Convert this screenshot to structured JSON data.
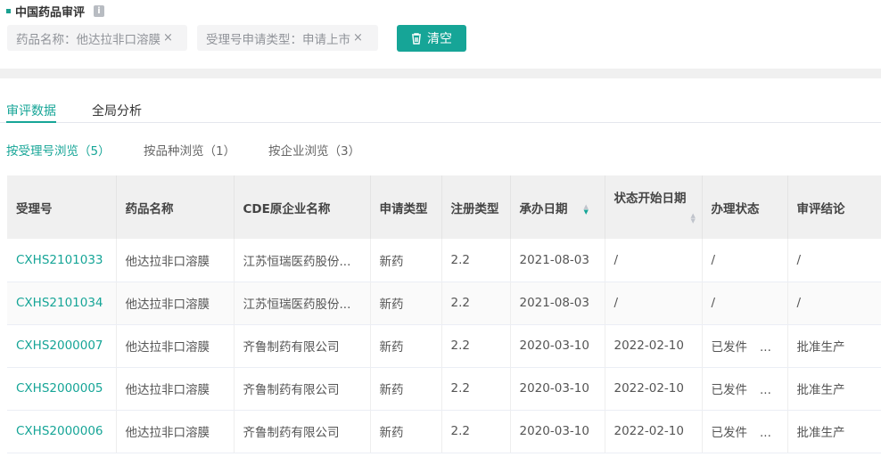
{
  "header": {
    "title": "中国药品审评",
    "info_icon": "info-icon"
  },
  "filters": [
    {
      "label": "药品名称：他达拉非口溶膜",
      "close": "×"
    },
    {
      "label": "受理号申请类型：申请上市",
      "close": "×"
    }
  ],
  "clear_button": "清空",
  "tabs": [
    "审评数据",
    "全局分析"
  ],
  "subtabs": [
    "按受理号浏览（5）",
    "按品种浏览（1）",
    "按企业浏览（3）"
  ],
  "table": {
    "columns": [
      "受理号",
      "药品名称",
      "CDE原企业名称",
      "申请类型",
      "注册类型",
      "承办日期",
      "状态开始日期",
      "办理状态",
      "审评结论"
    ],
    "rows": [
      [
        "CXHS2101033",
        "他达拉非口溶膜",
        "江苏恒瑞医药股份...",
        "新药",
        "2.2",
        "2021-08-03",
        "/",
        "/",
        "/"
      ],
      [
        "CXHS2101034",
        "他达拉非口溶膜",
        "江苏恒瑞医药股份...",
        "新药",
        "2.2",
        "2021-08-03",
        "/",
        "/",
        "/"
      ],
      [
        "CXHS2000007",
        "他达拉非口溶膜",
        "齐鲁制药有限公司",
        "新药",
        "2.2",
        "2020-03-10",
        "2022-02-10",
        "已发件",
        "批准生产"
      ],
      [
        "CXHS2000005",
        "他达拉非口溶膜",
        "齐鲁制药有限公司",
        "新药",
        "2.2",
        "2020-03-10",
        "2022-02-10",
        "已发件",
        "批准生产"
      ],
      [
        "CXHS2000006",
        "他达拉非口溶膜",
        "齐鲁制药有限公司",
        "新药",
        "2.2",
        "2020-03-10",
        "2022-02-10",
        "已发件",
        "批准生产"
      ]
    ],
    "ellipsis": "..."
  },
  "colors": {
    "accent": "#16a597"
  }
}
